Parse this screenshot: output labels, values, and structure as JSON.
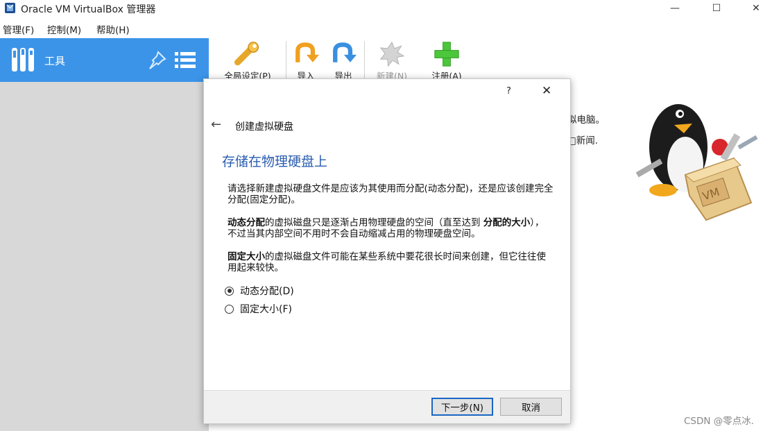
{
  "window": {
    "title": "Oracle VM VirtualBox 管理器",
    "minimize": "—",
    "maximize": "☐",
    "close": "✕"
  },
  "menu": [
    "管理(F)",
    "控制(M)",
    "帮助(H)"
  ],
  "sidebar": {
    "tools_label": "工具"
  },
  "toolbar": {
    "buttons": [
      {
        "label": "全局设定(P)",
        "icon": "wrench-icon",
        "enabled": true
      },
      {
        "label": "导入",
        "icon": "import-arrow-icon",
        "enabled": true
      },
      {
        "label": "导出",
        "icon": "export-arrow-icon",
        "enabled": true
      },
      {
        "label": "新建(N)",
        "icon": "new-machine-icon",
        "enabled": false
      },
      {
        "label": "注册(A)",
        "icon": "add-plus-icon",
        "enabled": true
      }
    ]
  },
  "background": {
    "line1": "拟电脑。",
    "line2": "□新闻."
  },
  "dialog": {
    "help": "?",
    "close": "✕",
    "back_arrow": "←",
    "title": "创建虚拟硬盘",
    "heading": "存储在物理硬盘上",
    "para1": "请选择新建虚拟硬盘文件是应该为其使用而分配(动态分配)，还是应该创建完全分配(固定分配)。",
    "para2_bold": "动态分配",
    "para2_a": "的虚拟磁盘只是逐渐占用物理硬盘的空间（直至达到 ",
    "para2_bold2": "分配的大小",
    "para2_b": "），不过当其内部空间不用时不会自动缩减占用的物理硬盘空间。",
    "para3_bold": "固定大小",
    "para3_a": "的虚拟磁盘文件可能在某些系统中要花很长时间来创建，但它往往使用起来较快。",
    "options": [
      {
        "label": "动态分配(D)",
        "checked": true
      },
      {
        "label": "固定大小(F)",
        "checked": false
      }
    ],
    "next_button": "下一步(N)",
    "cancel_button": "取消"
  },
  "watermark": "CSDN @零点冰."
}
